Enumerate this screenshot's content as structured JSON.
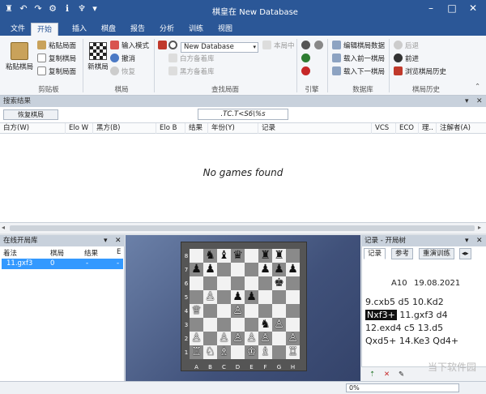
{
  "window": {
    "title": "棋皇在 New Database"
  },
  "tabs": [
    "文件",
    "开始",
    "插入",
    "棋盘",
    "报告",
    "分析",
    "训练",
    "视图"
  ],
  "ribbon": {
    "clipboard": {
      "big": "粘贴棋局",
      "items": [
        "粘贴局面",
        "复制棋局",
        "复制局面"
      ],
      "label": "剪贴板"
    },
    "game": {
      "big": "新棋局",
      "items": [
        "输入模式",
        "撤消",
        "恢复"
      ],
      "label": "棋局"
    },
    "search": {
      "database": "New Database",
      "center": "本局中",
      "white_book": "白方备着库",
      "black_book": "黑方备着库",
      "label": "查找局面"
    },
    "engine": {
      "label": "引擎"
    },
    "db": {
      "items": [
        "编辑棋局数据",
        "载入前一棋局",
        "载入下一棋局"
      ],
      "label": "数据库"
    },
    "history": {
      "items": [
        "后退",
        "前进",
        "浏览棋局历史"
      ],
      "label": "棋局历史"
    }
  },
  "search_results": {
    "title": "搜索结果",
    "restore_button": "恢复棋局",
    "search_text": ".TC.T<S6\\%s",
    "columns": [
      "白方(W)",
      "Elo W",
      "黑方(B)",
      "Elo B",
      "结果",
      "年份(Y)",
      "记录",
      "VCS",
      "ECO",
      "理..",
      "注解者(A)"
    ],
    "empty": "No games found"
  },
  "opening_book": {
    "title": "在线开局库",
    "columns": [
      "着法",
      "棋局",
      "结果",
      "E"
    ],
    "row": {
      "move": "11.gxf3",
      "games": "0",
      "result": "-",
      "elo": "-"
    }
  },
  "board": {
    "ranks": [
      "8",
      "7",
      "6",
      "5",
      "4",
      "3",
      "2",
      "1"
    ],
    "files": [
      "A",
      "B",
      "C",
      "D",
      "E",
      "F",
      "G",
      "H"
    ],
    "pieces": [
      {
        "sq": "c8",
        "p": "♝",
        "c": "b"
      },
      {
        "sq": "d8",
        "p": "♛",
        "c": "b"
      },
      {
        "sq": "f8",
        "p": "♜",
        "c": "b"
      },
      {
        "sq": "g8",
        "p": "♜",
        "c": "b"
      },
      {
        "sq": "b8",
        "p": "♞",
        "c": "b"
      },
      {
        "sq": "a7",
        "p": "♟",
        "c": "b"
      },
      {
        "sq": "b7",
        "p": "♟",
        "c": "b"
      },
      {
        "sq": "f7",
        "p": "♟",
        "c": "b"
      },
      {
        "sq": "g7",
        "p": "♟",
        "c": "b"
      },
      {
        "sq": "h7",
        "p": "♟",
        "c": "b"
      },
      {
        "sq": "g6",
        "p": "♚",
        "c": "b"
      },
      {
        "sq": "d5",
        "p": "♟",
        "c": "b"
      },
      {
        "sq": "e5",
        "p": "♟",
        "c": "b"
      },
      {
        "sq": "f3",
        "p": "♞",
        "c": "b"
      },
      {
        "sq": "a4",
        "p": "♕",
        "c": "w"
      },
      {
        "sq": "b5",
        "p": "♙",
        "c": "w"
      },
      {
        "sq": "d4",
        "p": "♙",
        "c": "w"
      },
      {
        "sq": "a2",
        "p": "♙",
        "c": "w"
      },
      {
        "sq": "c2",
        "p": "♙",
        "c": "w"
      },
      {
        "sq": "d2",
        "p": "♙",
        "c": "w"
      },
      {
        "sq": "e2",
        "p": "♙",
        "c": "w"
      },
      {
        "sq": "h2",
        "p": "♙",
        "c": "w"
      },
      {
        "sq": "f2",
        "p": "♙",
        "c": "w"
      },
      {
        "sq": "g3",
        "p": "♙",
        "c": "w"
      },
      {
        "sq": "a1",
        "p": "♖",
        "c": "w"
      },
      {
        "sq": "c1",
        "p": "♗",
        "c": "w"
      },
      {
        "sq": "e1",
        "p": "♔",
        "c": "w"
      },
      {
        "sq": "f1",
        "p": "♗",
        "c": "w"
      },
      {
        "sq": "h1",
        "p": "♖",
        "c": "w"
      },
      {
        "sq": "b1",
        "p": "♘",
        "c": "w"
      }
    ]
  },
  "notation": {
    "title": "记录 - 开局树",
    "tabs": [
      "记录",
      "参考",
      "重演训练"
    ],
    "eco": "A10",
    "date": "19.08.2021",
    "moves": [
      "9.cxb5  d5  10.Kd2",
      "Nxf3+",
      "11.gxf3  d4",
      "12.exd4  c5  13.d5",
      "Qxd5+  14.Ke3  Qd4+"
    ]
  },
  "status": {
    "progress": "0%"
  },
  "watermark": "当下软件园"
}
